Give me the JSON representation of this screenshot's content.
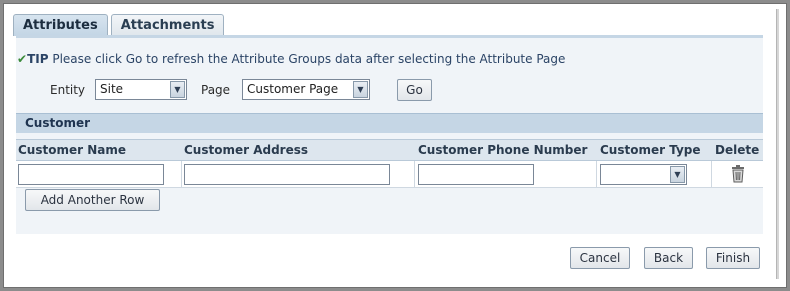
{
  "tabs": [
    {
      "label": "Attributes",
      "active": true
    },
    {
      "label": "Attachments",
      "active": false
    }
  ],
  "tip": {
    "label": "TIP",
    "text": " Please click Go to refresh the Attribute Groups data after selecting the Attribute Page"
  },
  "filters": {
    "entity_label": "Entity",
    "entity_value": "Site",
    "page_label": "Page",
    "page_value": "Customer Page",
    "go_label": "Go"
  },
  "section": {
    "title": "Customer"
  },
  "table": {
    "columns": [
      "Customer Name",
      "Customer Address",
      "Customer Phone Number",
      "Customer Type",
      "Delete"
    ],
    "rows": [
      {
        "name": "",
        "address": "",
        "phone": "",
        "type": ""
      }
    ],
    "add_row_label": "Add Another Row"
  },
  "actions": {
    "cancel": "Cancel",
    "back": "Back",
    "finish": "Finish"
  },
  "colors": {
    "section_header_bg": "#c5d6e5",
    "tip_check": "#3a8a3a",
    "tip_text": "#2b4466"
  },
  "icons": [
    "check-icon",
    "dropdown-arrow-icon",
    "trash-icon"
  ]
}
